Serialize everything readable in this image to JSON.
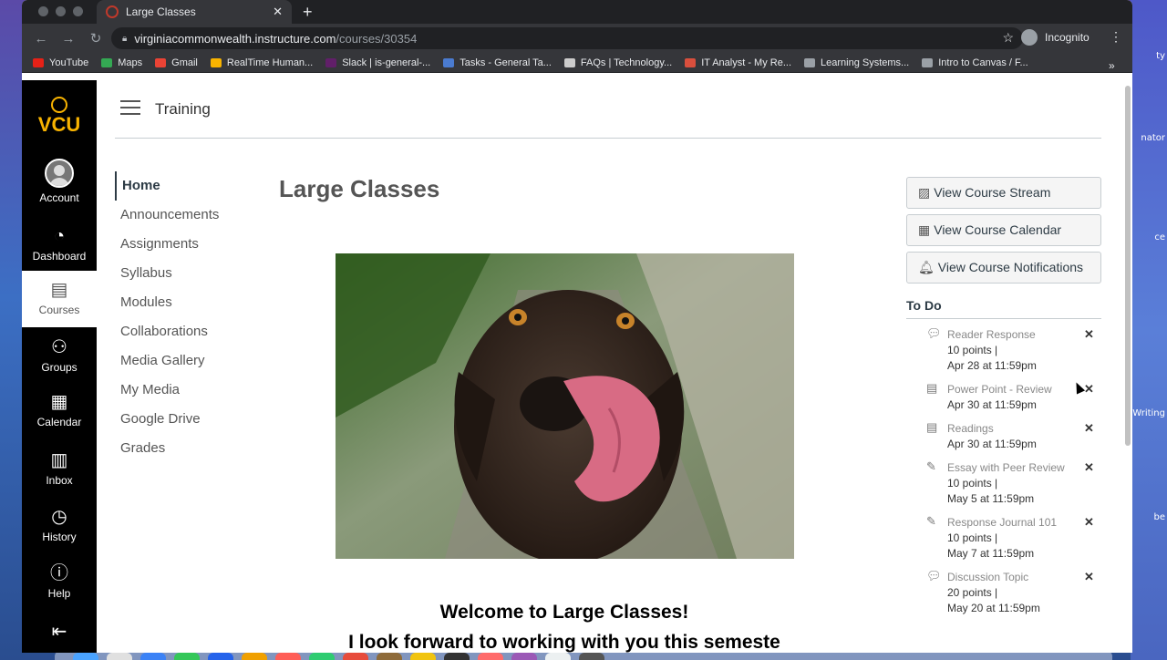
{
  "browser": {
    "tab_title": "Large Classes",
    "url_host": "virginiacommonwealth.instructure.com",
    "url_path": "/courses/30354",
    "profile_label": "Incognito"
  },
  "bookmarks": [
    {
      "label": "YouTube",
      "color": "#e62117"
    },
    {
      "label": "Maps",
      "color": "#34a853"
    },
    {
      "label": "Gmail",
      "color": "#ea4335"
    },
    {
      "label": "RealTime Human...",
      "color": "#f8b300"
    },
    {
      "label": "Slack | is-general-...",
      "color": "#611f69"
    },
    {
      "label": "Tasks - General Ta...",
      "color": "#4a7bd0"
    },
    {
      "label": "FAQs | Technology...",
      "color": "#cccccc"
    },
    {
      "label": "IT Analyst - My Re...",
      "color": "#d94f3d"
    },
    {
      "label": "Learning Systems...",
      "color": "#9aa0a6"
    },
    {
      "label": "Intro to Canvas / F...",
      "color": "#9aa0a6"
    }
  ],
  "global_nav": {
    "logo_text": "VCU",
    "items": [
      {
        "label": "Account",
        "icon": "account-icon"
      },
      {
        "label": "Dashboard",
        "icon": "dashboard-icon"
      },
      {
        "label": "Courses",
        "icon": "courses-icon",
        "active": true
      },
      {
        "label": "Groups",
        "icon": "groups-icon"
      },
      {
        "label": "Calendar",
        "icon": "calendar-icon"
      },
      {
        "label": "Inbox",
        "icon": "inbox-icon"
      },
      {
        "label": "History",
        "icon": "history-icon"
      },
      {
        "label": "Help",
        "icon": "help-icon"
      }
    ]
  },
  "breadcrumb": "Training",
  "course_nav": [
    "Home",
    "Announcements",
    "Assignments",
    "Syllabus",
    "Modules",
    "Collaborations",
    "Media Gallery",
    "My Media",
    "Google Drive",
    "Grades"
  ],
  "main": {
    "title": "Large Classes",
    "hero_alt": "dog-photo",
    "welcome": "Welcome to Large Classes!",
    "cut_line": "I look forward to working with you this semeste"
  },
  "sidebar": {
    "buttons": [
      "View Course Stream",
      "View Course Calendar",
      "View Course Notifications"
    ],
    "todo_heading": "To Do",
    "todo": [
      {
        "name": "Reader Response",
        "points": "10 points  |",
        "due": "Apr 28 at 11:59pm",
        "icon": "discussion-icon"
      },
      {
        "name": "Power Point - Review",
        "points": "",
        "due": "Apr 30 at 11:59pm",
        "icon": "quiz-icon"
      },
      {
        "name": "Readings",
        "points": "",
        "due": "Apr 30 at 11:59pm",
        "icon": "quiz-icon"
      },
      {
        "name": "Essay with Peer Review",
        "points": "10 points  |",
        "due": "May 5 at 11:59pm",
        "icon": "assignment-icon"
      },
      {
        "name": "Response Journal 101",
        "points": "10 points  |",
        "due": "May 7 at 11:59pm",
        "icon": "assignment-icon"
      },
      {
        "name": "Discussion Topic",
        "points": "20 points  |",
        "due": "May 20 at 11:59pm",
        "icon": "discussion-icon"
      }
    ]
  },
  "desktop_labels": [
    "ty",
    "nator",
    "ce",
    "Writing",
    "be"
  ]
}
